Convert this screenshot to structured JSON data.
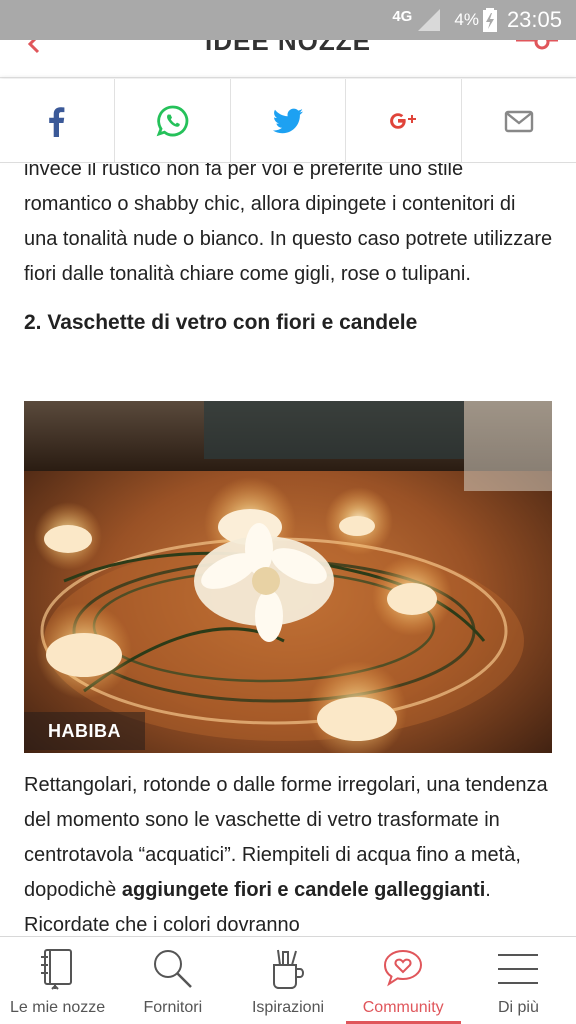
{
  "status_bar": {
    "network": "4G",
    "battery_percent": "4%",
    "time": "23:05"
  },
  "header": {
    "title": "IDEE NOZZE"
  },
  "share_bar": {
    "items": [
      {
        "icon": "facebook-icon",
        "color": "#3b5998"
      },
      {
        "icon": "whatsapp-icon",
        "color": "#25c15a"
      },
      {
        "icon": "twitter-icon",
        "color": "#1da1f2"
      },
      {
        "icon": "google-plus-icon",
        "color": "#e0443a"
      },
      {
        "icon": "email-icon",
        "color": "#888888"
      }
    ]
  },
  "article": {
    "paragraph1": "invece il rustico non fa per voi e preferite uno stile romantico o shabby chic, allora dipingete i contenitori di una tonalità nude o bianco. In questo caso potrete utilizzare fiori dalle tonalità chiare come gigli, rose o tulipani.",
    "heading2": "2. Vaschette di vetro con fiori e candele",
    "image_credit": "HABIBA",
    "paragraph2": {
      "part1": "Rettangolari, rotonde o dalle forme irregolari, una tendenza del momento sono le vaschette di vetro trasformate in centrotavola “acquatici”. Riempiteli di acqua fino a metà, dopodichè ",
      "bold1": "aggiungete fiori e candele galleggianti",
      "part2": ". Ricordate che i colori dovranno"
    }
  },
  "bottom_nav": {
    "accent_color": "#e0565b",
    "items": [
      {
        "label": "Le mie nozze",
        "icon": "notebook-icon"
      },
      {
        "label": "Fornitori",
        "icon": "search-icon"
      },
      {
        "label": "Ispirazioni",
        "icon": "inspiration-icon"
      },
      {
        "label": "Community",
        "icon": "heart-chat-icon",
        "active": true
      },
      {
        "label": "Di più",
        "icon": "menu-icon"
      }
    ]
  }
}
